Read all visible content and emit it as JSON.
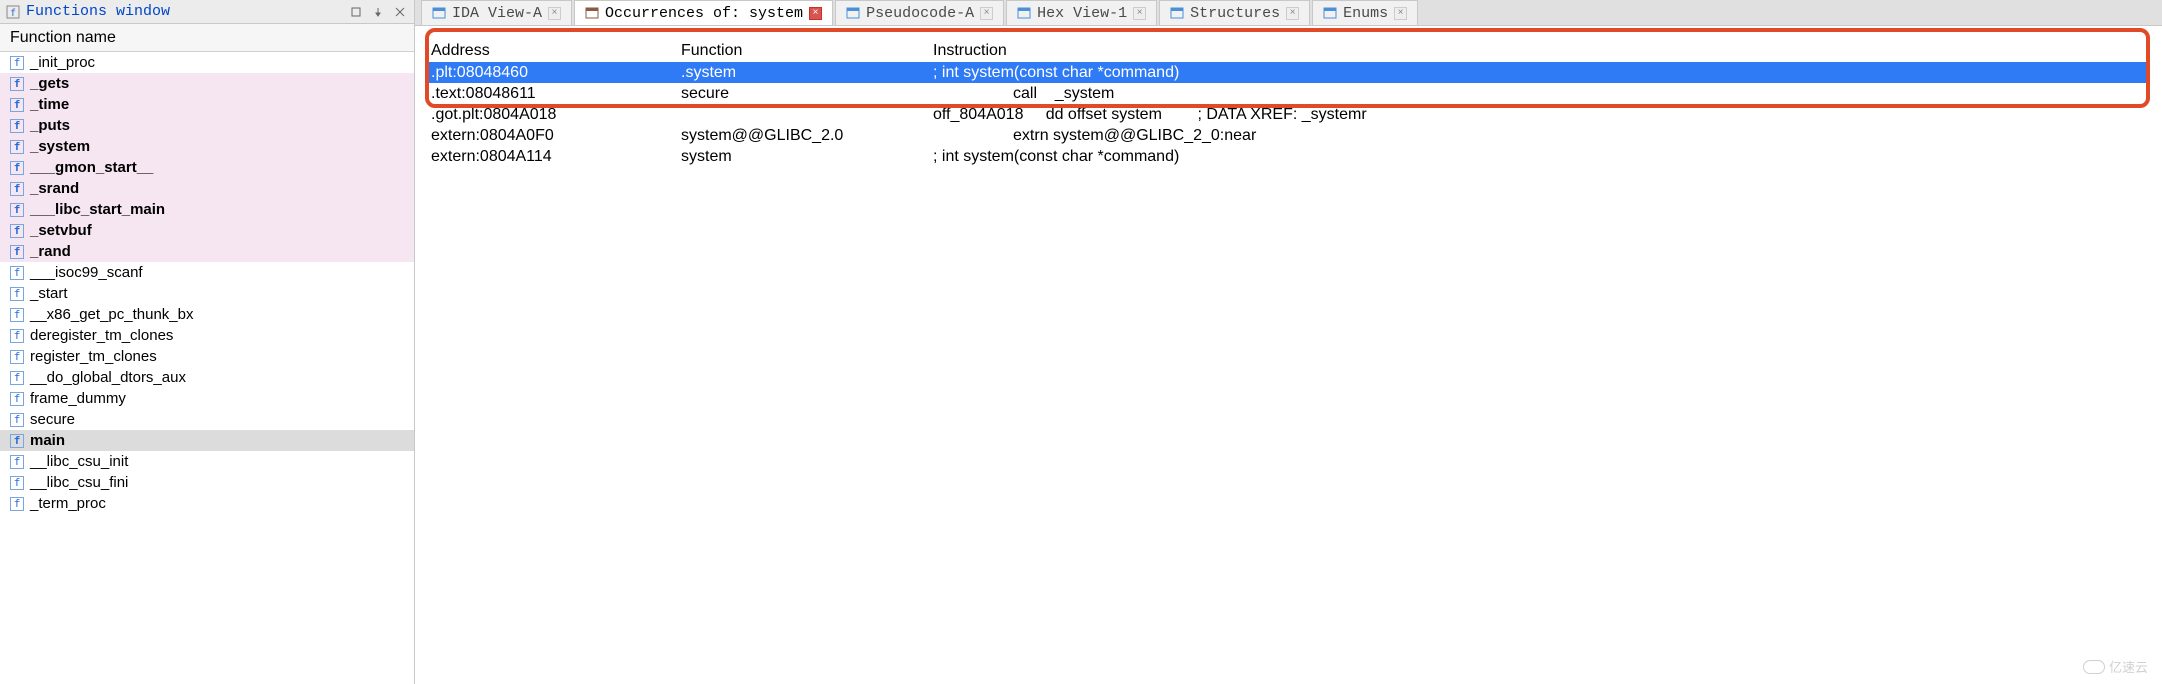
{
  "left": {
    "title": "Functions window",
    "header": "Function name",
    "items": [
      {
        "label": "_init_proc",
        "pink": false,
        "sel": false
      },
      {
        "label": "_gets",
        "pink": true,
        "sel": false
      },
      {
        "label": "_time",
        "pink": true,
        "sel": false
      },
      {
        "label": "_puts",
        "pink": true,
        "sel": false
      },
      {
        "label": "_system",
        "pink": true,
        "sel": false
      },
      {
        "label": "___gmon_start__",
        "pink": true,
        "sel": false
      },
      {
        "label": "_srand",
        "pink": true,
        "sel": false
      },
      {
        "label": "___libc_start_main",
        "pink": true,
        "sel": false
      },
      {
        "label": "_setvbuf",
        "pink": true,
        "sel": false
      },
      {
        "label": "_rand",
        "pink": true,
        "sel": false
      },
      {
        "label": "___isoc99_scanf",
        "pink": false,
        "sel": false
      },
      {
        "label": "_start",
        "pink": false,
        "sel": false
      },
      {
        "label": "__x86_get_pc_thunk_bx",
        "pink": false,
        "sel": false
      },
      {
        "label": "deregister_tm_clones",
        "pink": false,
        "sel": false
      },
      {
        "label": "register_tm_clones",
        "pink": false,
        "sel": false
      },
      {
        "label": "__do_global_dtors_aux",
        "pink": false,
        "sel": false
      },
      {
        "label": "frame_dummy",
        "pink": false,
        "sel": false
      },
      {
        "label": "secure",
        "pink": false,
        "sel": false
      },
      {
        "label": "main",
        "pink": false,
        "sel": true
      },
      {
        "label": "__libc_csu_init",
        "pink": false,
        "sel": false
      },
      {
        "label": "__libc_csu_fini",
        "pink": false,
        "sel": false
      },
      {
        "label": "_term_proc",
        "pink": false,
        "sel": false
      }
    ]
  },
  "tabs": [
    {
      "label": "IDA View-A",
      "icon_color": "#4a90d9",
      "active": false,
      "close_red": false
    },
    {
      "label": "Occurrences of: system",
      "icon_color": "#8a5a44",
      "active": true,
      "close_red": true
    },
    {
      "label": "Pseudocode-A",
      "icon_color": "#4a90d9",
      "active": false,
      "close_red": false
    },
    {
      "label": "Hex View-1",
      "icon_color": "#4a90d9",
      "active": false,
      "close_red": false
    },
    {
      "label": "Structures",
      "icon_color": "#4a90d9",
      "active": false,
      "close_red": false
    },
    {
      "label": "Enums",
      "icon_color": "#4a90d9",
      "active": false,
      "close_red": false
    }
  ],
  "occ": {
    "headers": {
      "addr": "Address",
      "func": "Function",
      "inst": "Instruction"
    },
    "rows": [
      {
        "addr": ".plt:08048460",
        "func": ".system",
        "inst": "; int system(const char *command)",
        "selected": true
      },
      {
        "addr": ".text:08048611",
        "func": "secure",
        "inst": "                  call    _system",
        "selected": false
      },
      {
        "addr": ".got.plt:0804A018",
        "func": "",
        "inst": "off_804A018     dd offset system        ; DATA XREF: _systemr",
        "selected": false
      },
      {
        "addr": "extern:0804A0F0",
        "func": "system@@GLIBC_2.0",
        "inst": "                  extrn system@@GLIBC_2_0:near",
        "selected": false
      },
      {
        "addr": "extern:0804A114",
        "func": "system",
        "inst": "; int system(const char *command)",
        "selected": false
      }
    ]
  },
  "watermark": "亿速云"
}
